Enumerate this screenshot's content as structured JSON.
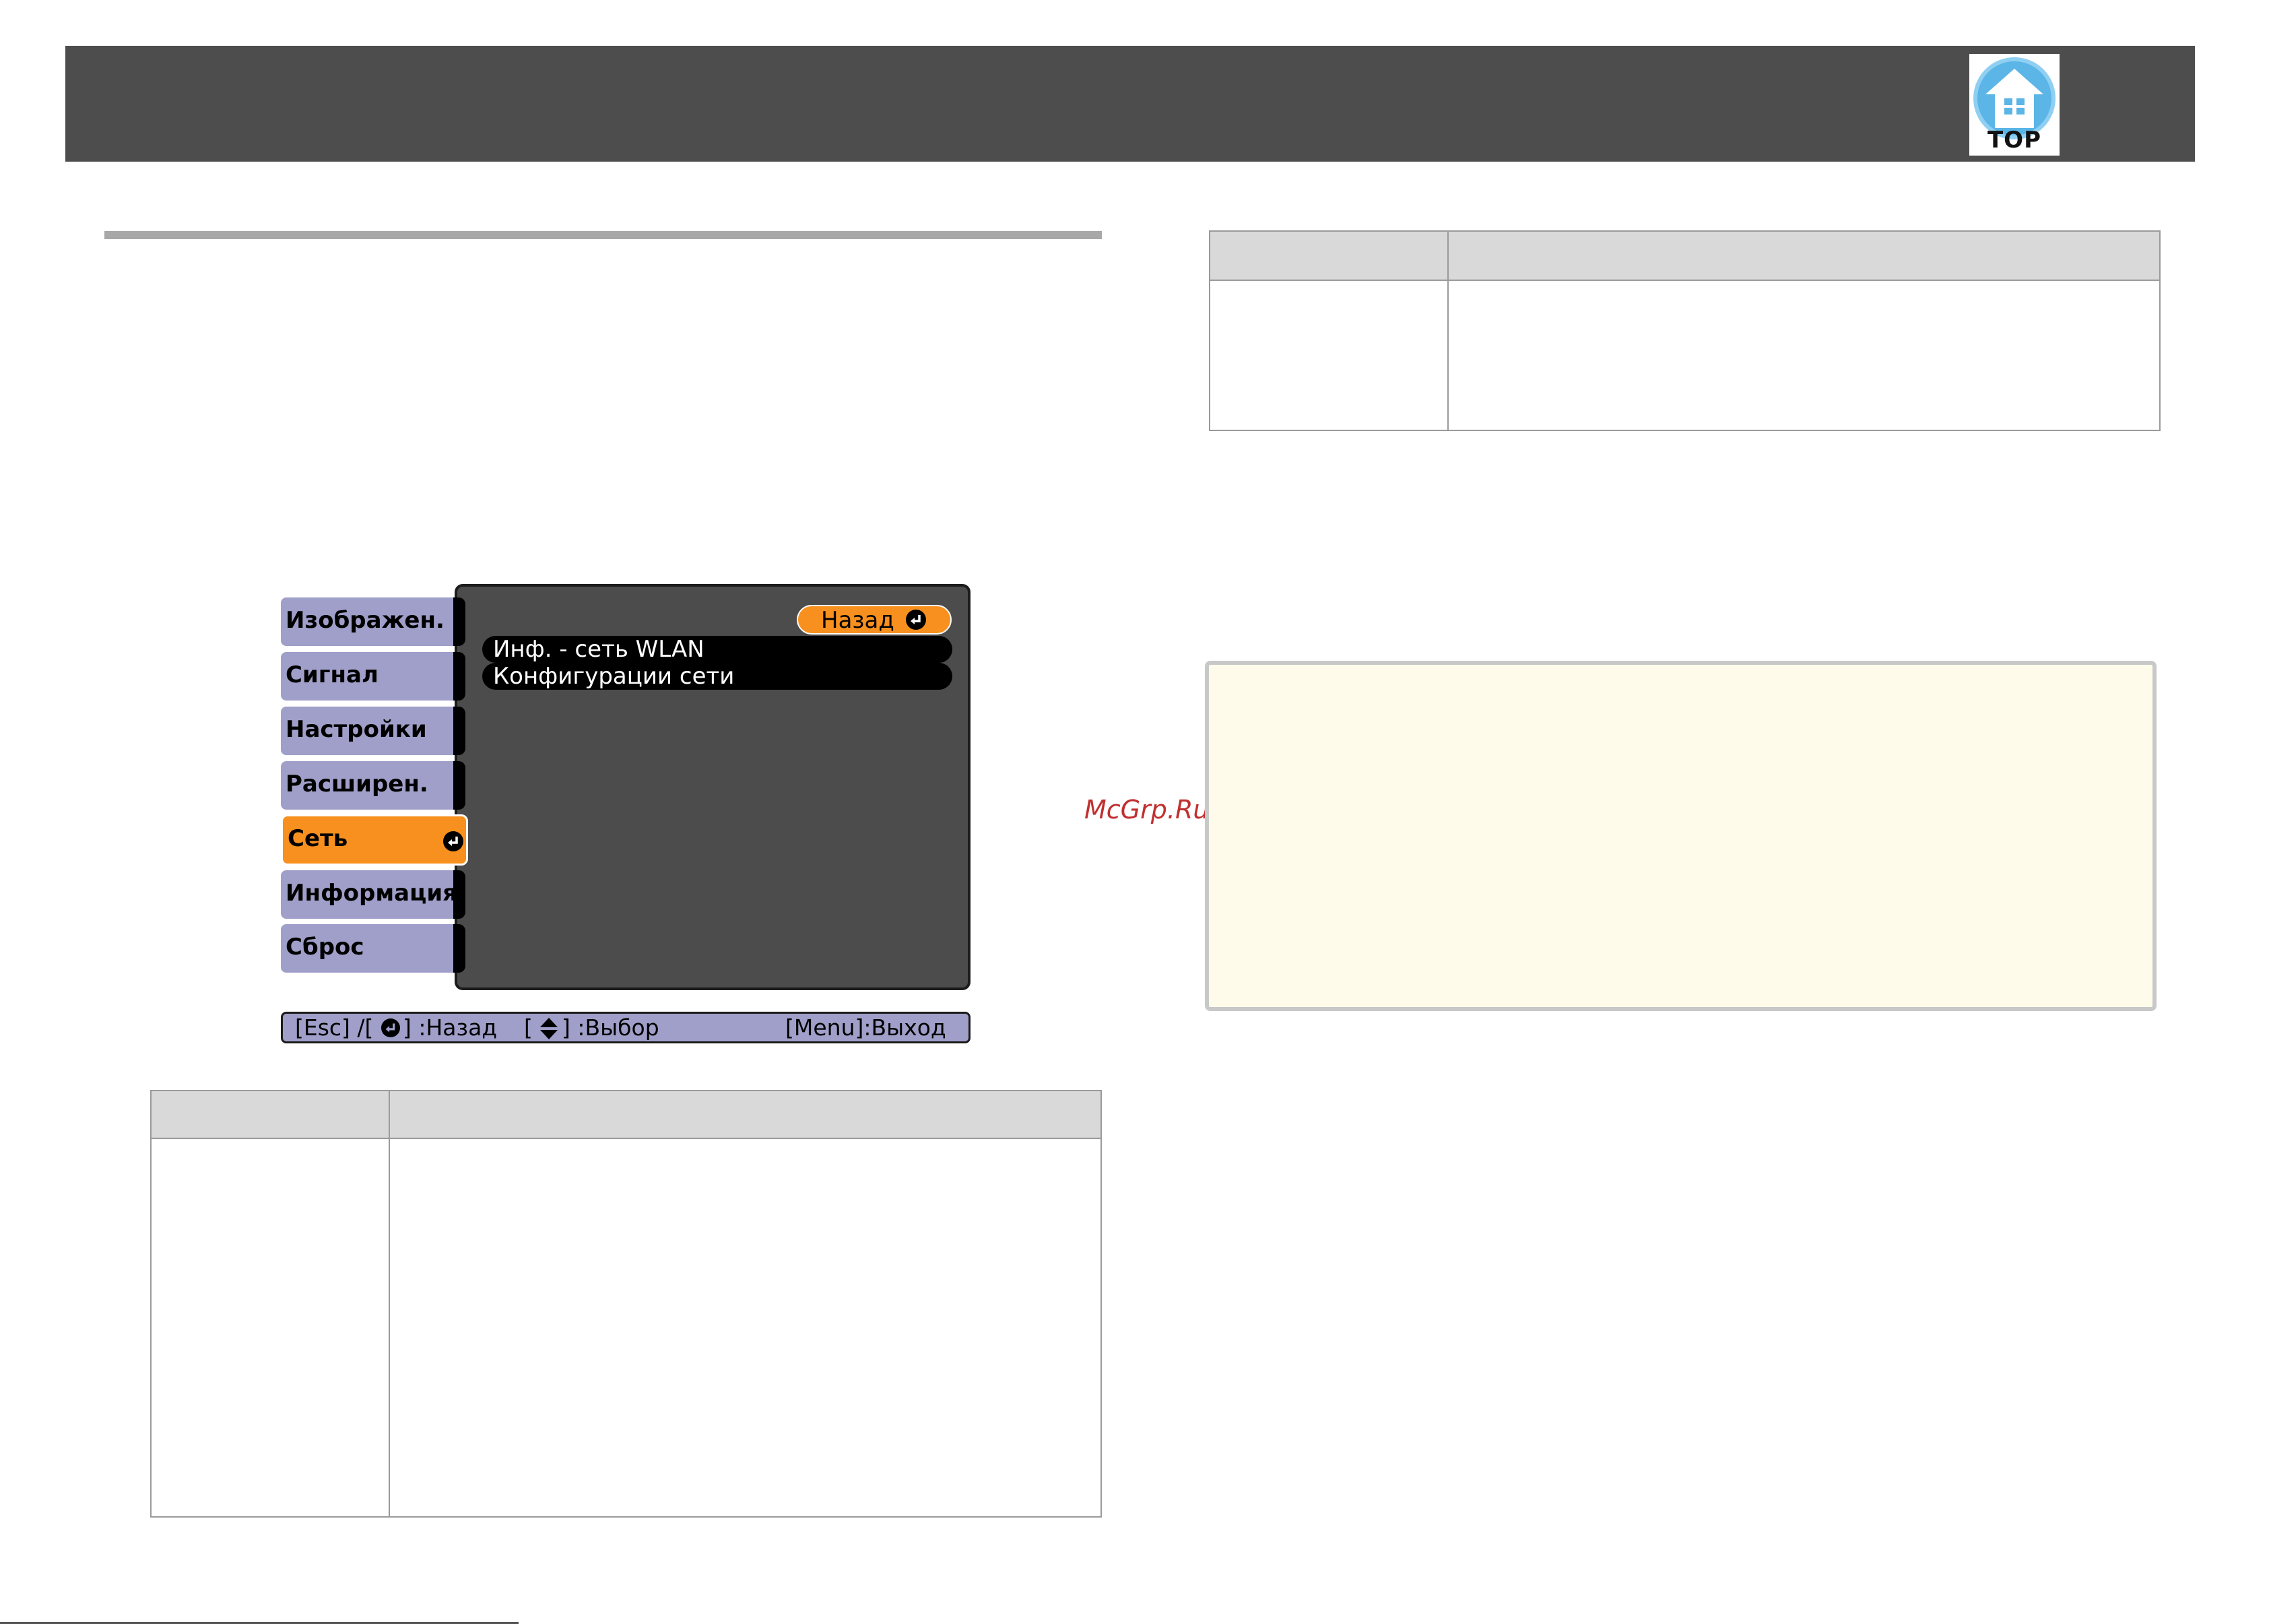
{
  "header": {
    "logo_text": "TOP",
    "logo_icon": "top-house-icon",
    "colors": {
      "bar": "#4d4d4d",
      "logo_blue": "#5bb5e6"
    }
  },
  "osd_menu": {
    "sidebar_items": [
      {
        "label": "Изображен.",
        "active": false
      },
      {
        "label": "Сигнал",
        "active": false
      },
      {
        "label": "Настройки",
        "active": false
      },
      {
        "label": "Расширен.",
        "active": false
      },
      {
        "label": "Сеть",
        "active": true
      },
      {
        "label": "Информация",
        "active": false
      },
      {
        "label": "Сброс",
        "active": false
      }
    ],
    "back_button": "Назад",
    "submenu_items": [
      "Инф. - сеть WLAN",
      "Конфигурации сети"
    ],
    "footer": {
      "back_hint_prefix": "[Esc] /[",
      "back_hint_suffix": "] :Назад",
      "select_hint_prefix": "[",
      "select_hint_suffix": "] :Выбор",
      "exit_hint": "[Menu]:Выход"
    },
    "colors": {
      "sidebar": "#9f9fc9",
      "active": "#f7901e",
      "panel": "#4c4c4c",
      "row": "#000000"
    }
  },
  "watermark": "McGrp.Ru",
  "note_box_color": "#fffbea"
}
